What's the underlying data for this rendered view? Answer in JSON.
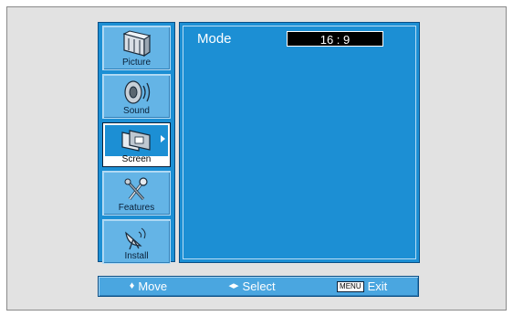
{
  "sidebar": {
    "items": [
      {
        "label": "Picture",
        "icon": "picture-icon"
      },
      {
        "label": "Sound",
        "icon": "sound-icon"
      },
      {
        "label": "Screen",
        "icon": "screen-icon",
        "active": true
      },
      {
        "label": "Features",
        "icon": "features-icon"
      },
      {
        "label": "Install",
        "icon": "install-icon"
      }
    ]
  },
  "main": {
    "mode_label": "Mode",
    "mode_value": "16 : 9"
  },
  "help": {
    "move_glyph": "♦",
    "move_label": "Move",
    "select_glyph": "◂▸",
    "select_label": "Select",
    "menu_key": "MENU",
    "exit_label": "Exit"
  },
  "colors": {
    "panel_blue": "#1c8fd4",
    "item_blue": "#64b4e6",
    "help_blue": "#4aa6e0",
    "background_gray": "#e2e2e2"
  }
}
